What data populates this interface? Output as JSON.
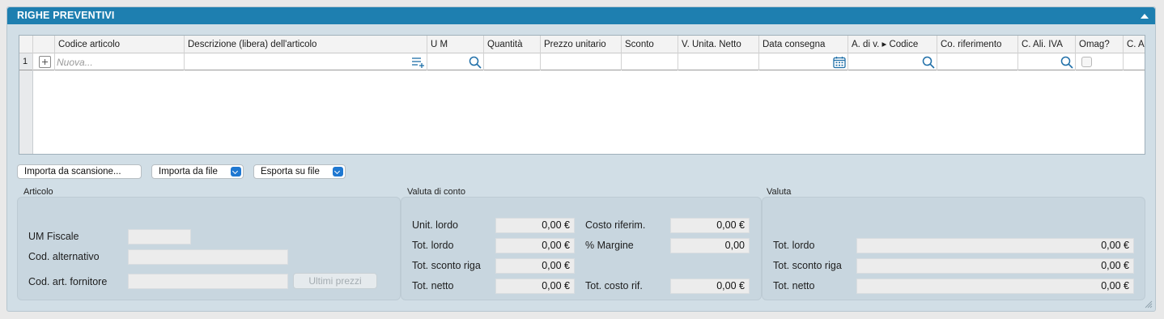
{
  "panel": {
    "title": "RIGHE PREVENTIVI"
  },
  "grid": {
    "columns": [
      "Codice articolo",
      "Descrizione (libera) dell'articolo",
      "U M",
      "Quantità",
      "Prezzo unitario",
      "Sconto",
      "V. Unita. Netto",
      "Data consegna",
      "A. di v. ▸ Codice",
      "Co. riferimento",
      "C. Ali. IVA",
      "Omag?",
      "C. Ac"
    ],
    "row_number": "1",
    "new_placeholder": "Nuova..."
  },
  "buttons": {
    "import_scan": "Importa da scansione...",
    "import_file": "Importa da file",
    "export_file": "Esporta su file"
  },
  "articolo": {
    "title": "Articolo",
    "um_fiscale_label": "UM Fiscale",
    "um_fiscale_value": "",
    "cod_alternativo_label": "Cod. alternativo",
    "cod_alternativo_value": "",
    "cod_fornitore_label": "Cod. art. fornitore",
    "cod_fornitore_value": "",
    "ultimi_prezzi": "Ultimi prezzi"
  },
  "valuta_conto": {
    "title": "Valuta di conto",
    "unit_lordo_label": "Unit. lordo",
    "unit_lordo": "0,00 €",
    "tot_lordo_label": "Tot. lordo",
    "tot_lordo": "0,00 €",
    "tot_sconto_riga_label": "Tot. sconto riga",
    "tot_sconto_riga": "0,00 €",
    "tot_netto_label": "Tot. netto",
    "tot_netto": "0,00 €",
    "costo_riferim_label": "Costo riferim.",
    "costo_riferim": "0,00 €",
    "margine_label": "% Margine",
    "margine": "0,00",
    "tot_costo_rif_label": "Tot. costo rif.",
    "tot_costo_rif": "0,00 €"
  },
  "valuta": {
    "title": "Valuta",
    "tot_lordo_label": "Tot. lordo",
    "tot_lordo": "0,00 €",
    "tot_sconto_riga_label": "Tot. sconto riga",
    "tot_sconto_riga": "0,00 €",
    "tot_netto_label": "Tot. netto",
    "tot_netto": "0,00 €"
  },
  "colors": {
    "titlebar": "#1e7fb0",
    "panel": "#d1dee6",
    "icon": "#1f6fa8",
    "dropdown": "#1f78d1"
  },
  "icons": [
    "collapse-icon",
    "add-row-icon",
    "list-add-icon",
    "search-icon",
    "calendar-icon",
    "resize-grip-icon"
  ]
}
